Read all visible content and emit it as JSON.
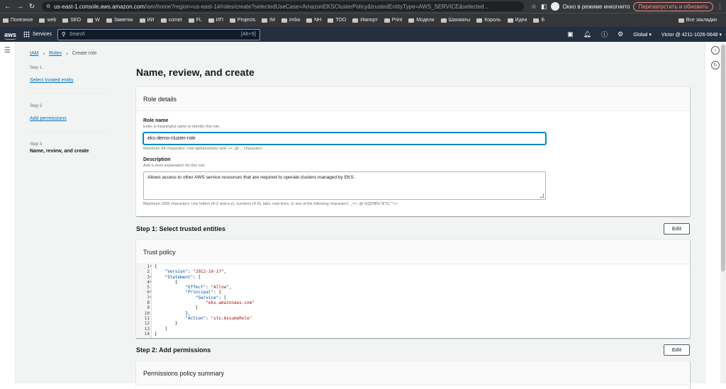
{
  "browser": {
    "url_host": "us-east-1.console.aws.amazon.com",
    "url_path": "/iam/home?region=us-east-1#/roles/create?selectedUseCase=AmazonEKSClusterPolicy&trustedEntityType=AWS_SERVICE&selected...",
    "incognito_label": "Окно в режиме инкогнито",
    "restart_label": "Перезапустить и обновить",
    "bookmarks": [
      "Полезное",
      "web",
      "SEO",
      "W",
      "Заметки",
      "ИИ",
      "comet",
      "FL",
      "ИП",
      "Projects",
      "IM",
      "imba",
      "NH",
      "TOO",
      "Импорт",
      "Print",
      "Модели",
      "Шахматы",
      "Король",
      "Идеи",
      "Б"
    ],
    "all_bookmarks": "Все закладки"
  },
  "aws": {
    "logo": "aws",
    "services": "Services",
    "search_placeholder": "Search",
    "search_shortcut": "[Alt+S]",
    "region": "Global ▾",
    "account": "Victor @ 4211-1026-5648 ▾"
  },
  "breadcrumb": {
    "root": "IAM",
    "roles": "Roles",
    "current": "Create role"
  },
  "steps": [
    {
      "num": "Step 1",
      "label": "Select trusted entity"
    },
    {
      "num": "Step 2",
      "label": "Add permissions"
    },
    {
      "num": "Step 3",
      "label": "Name, review, and create"
    }
  ],
  "page_title": "Name, review, and create",
  "role_details": {
    "heading": "Role details",
    "name_label": "Role name",
    "name_desc": "Enter a meaningful name to identify this role.",
    "name_value": "eks-demo-cluster-role",
    "name_hint": "Maximum 64 characters. Use alphanumeric and '+=,.@-_' characters.",
    "desc_label": "Description",
    "desc_desc": "Add a short explanation for this role.",
    "desc_value": "Allows access to other AWS service resources that are required to operate clusters managed by EKS.",
    "desc_hint": "Maximum 1000 characters. Use letters (A-Z and a-z), numbers (0-9), tabs, new lines, or any of the following characters: _+=,.@-/\\[{}]!#$%^&*();:'\"<>`"
  },
  "step1": {
    "title": "Step 1: Select trusted entities",
    "edit": "Edit",
    "panel_heading": "Trust policy"
  },
  "trust_policy_lines": [
    "{",
    "    \"Version\": \"2012-10-17\",",
    "    \"Statement\": [",
    "        {",
    "            \"Effect\": \"Allow\",",
    "            \"Principal\": {",
    "                \"Service\": [",
    "                    \"eks.amazonaws.com\"",
    "                ]",
    "            },",
    "            \"Action\": \"sts:AssumeRole\"",
    "        }",
    "    ]",
    "}"
  ],
  "step2": {
    "title": "Step 2: Add permissions",
    "edit": "Edit",
    "panel_heading": "Permissions policy summary"
  }
}
